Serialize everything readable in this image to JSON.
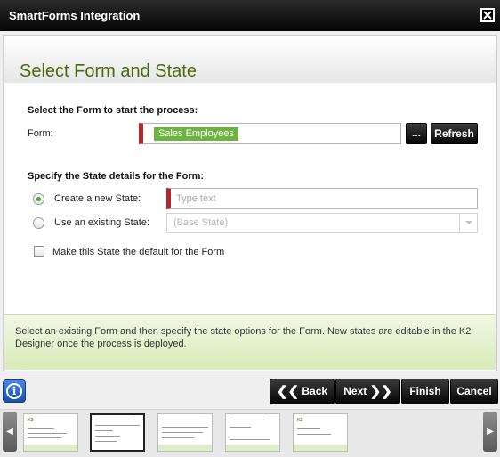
{
  "window": {
    "title": "SmartForms Integration"
  },
  "page": {
    "heading": "Select Form and State"
  },
  "form_section": {
    "label": "Select the Form to start the process:",
    "form_label": "Form:",
    "form_value": "Sales Employees",
    "browse_label": "...",
    "refresh_label": "Refresh"
  },
  "state_section": {
    "label": "Specify the State details for the Form:",
    "new_state_label": "Create a new State:",
    "new_state_placeholder": "Type text",
    "new_state_value": "",
    "existing_state_label": "Use an existing State:",
    "existing_state_value": "(Base State)",
    "selected_option": "new",
    "default_label": "Make this State the default for the Form",
    "default_checked": false
  },
  "info": {
    "text": "Select an existing Form and then specify the state options for the Form. New states are editable in the K2 Designer once the process is deployed."
  },
  "footer": {
    "back_label": "Back",
    "next_label": "Next",
    "finish_label": "Finish",
    "cancel_label": "Cancel"
  },
  "thumbnails": {
    "logo_text": "K2",
    "active_index": 1,
    "count": 5
  },
  "colors": {
    "accent_green": "#6cb33f",
    "heading_green": "#4a6b0b",
    "required_red": "#b3262b"
  }
}
